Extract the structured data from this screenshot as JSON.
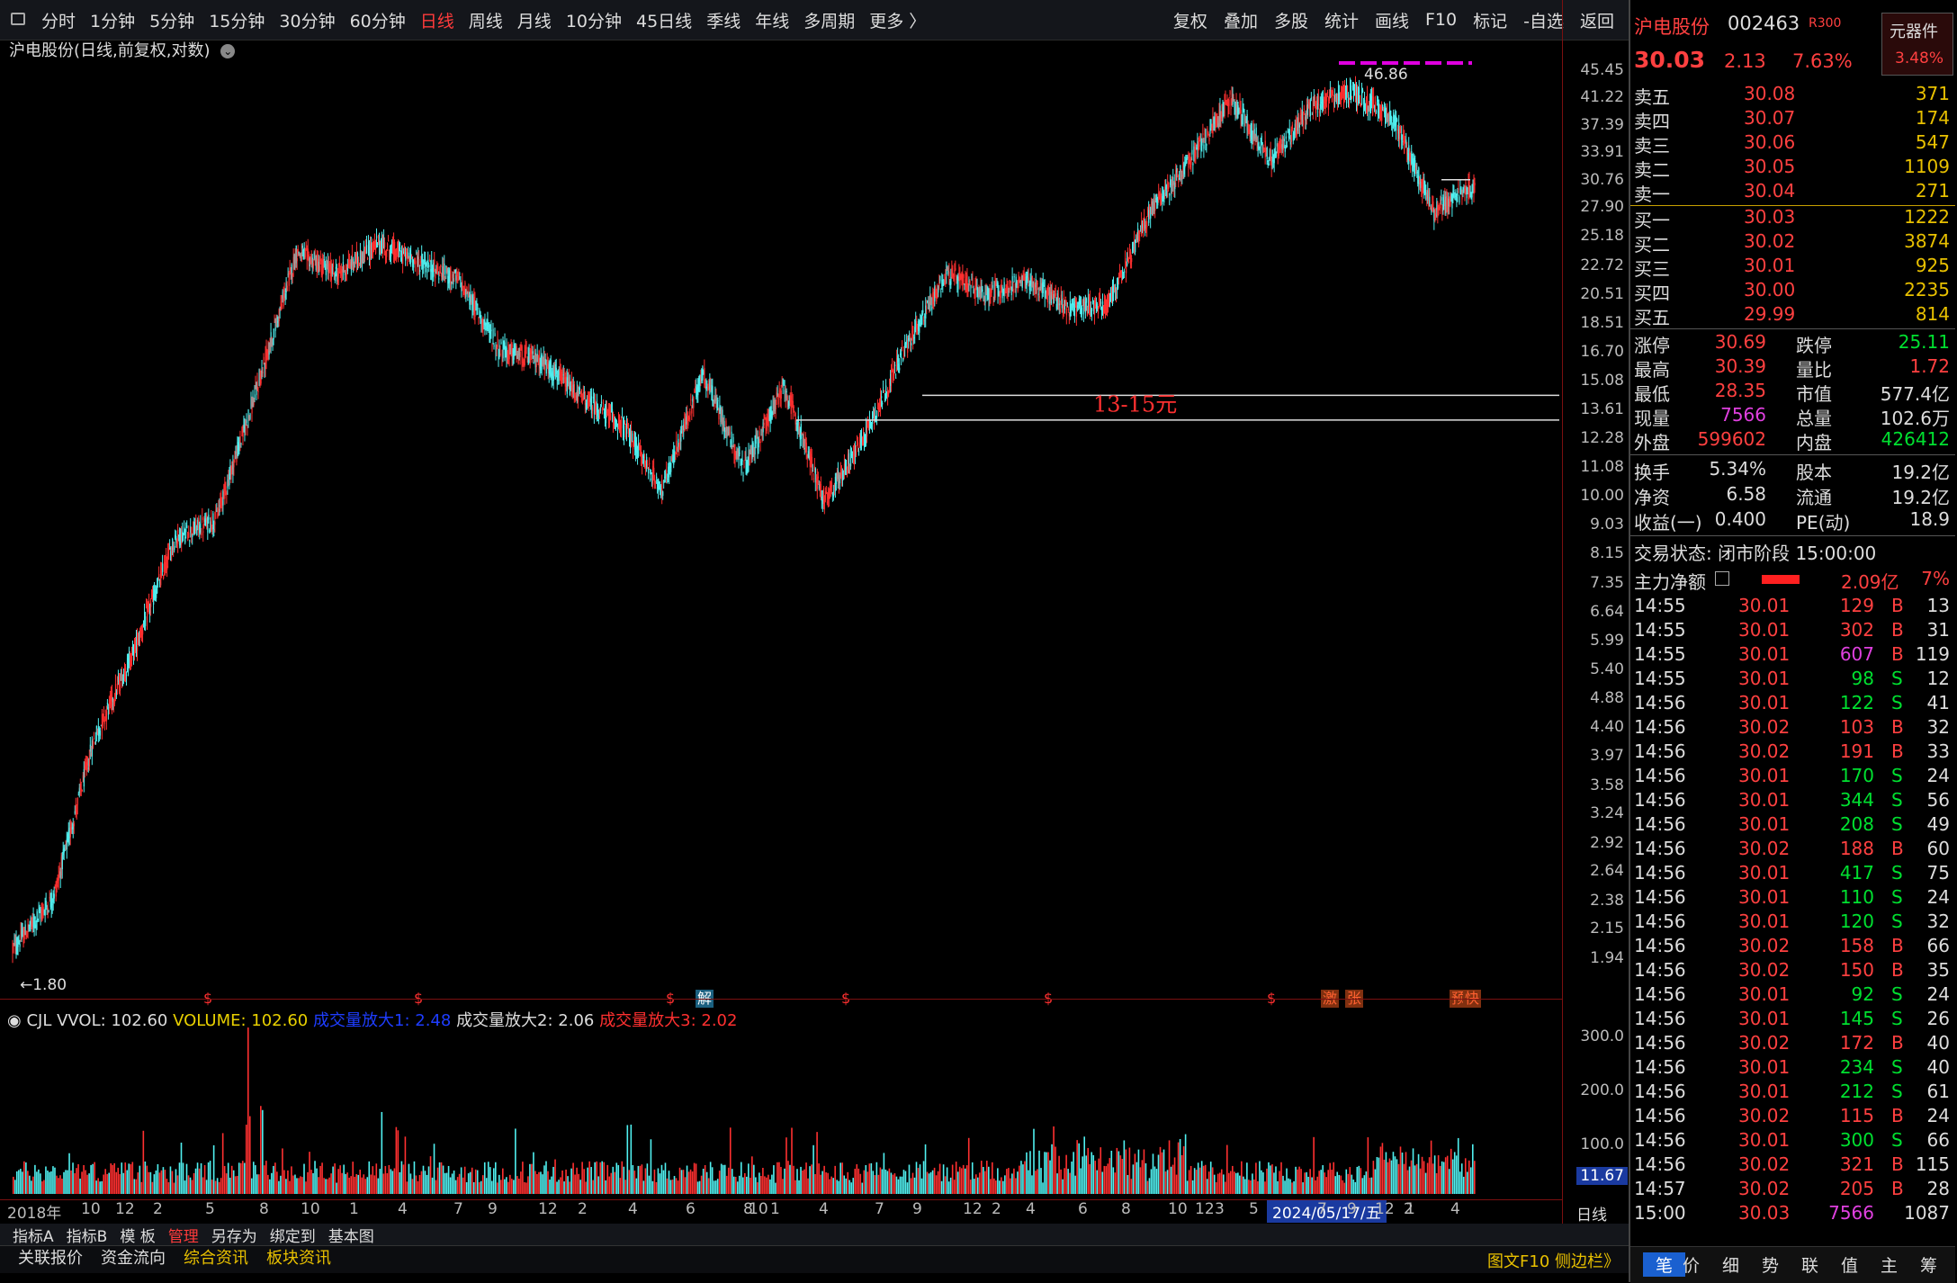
{
  "topbar": {
    "periods": [
      "分时",
      "1分钟",
      "5分钟",
      "15分钟",
      "30分钟",
      "60分钟",
      "日线",
      "周线",
      "月线",
      "10分钟",
      "45日线",
      "季线",
      "年线",
      "多周期",
      "更多 〉"
    ],
    "active_period": "日线",
    "tools": [
      "复权",
      "叠加",
      "多股",
      "统计",
      "画线",
      "F10",
      "标记",
      "-自选",
      "返回"
    ]
  },
  "chart": {
    "title": "沪电股份(日线,前复权,对数)",
    "low_label": "←1.80",
    "high_label": "46.86",
    "annotation": "13-15元",
    "y_ticks": [
      "45.45",
      "41.22",
      "37.39",
      "33.91",
      "30.76",
      "27.90",
      "25.18",
      "22.72",
      "20.51",
      "18.51",
      "16.70",
      "15.08",
      "13.61",
      "12.28",
      "11.08",
      "10.00",
      "9.03",
      "8.15",
      "7.35",
      "6.64",
      "5.99",
      "5.40",
      "4.88",
      "4.40",
      "3.97",
      "3.58",
      "3.24",
      "2.92",
      "2.64",
      "2.38",
      "2.15",
      "1.94"
    ],
    "markers": [
      "$",
      "$",
      "$",
      "解",
      "$",
      "$",
      "$",
      "激",
      "张",
      "预",
      "快"
    ]
  },
  "chart_data": {
    "type": "line",
    "title": "沪电股份(日线,前复权,对数)",
    "y_scale": "log",
    "ylim": [
      1.8,
      46.86
    ],
    "x": [
      "2018年",
      "10",
      "12",
      "2",
      "5",
      "8",
      "10",
      "1",
      "4",
      "7",
      "9",
      "12",
      "2",
      "4",
      "6",
      "8",
      "10",
      "1",
      "4",
      "7",
      "9",
      "12",
      "2",
      "4",
      "6",
      "8",
      "10",
      "12",
      "3",
      "5",
      "7",
      "9",
      "12",
      "2",
      "4",
      "6",
      "8",
      "10",
      "1",
      "4"
    ],
    "close": [
      2.0,
      2.4,
      4.2,
      5.8,
      8.6,
      9.2,
      14.5,
      23.8,
      22.0,
      24.5,
      23.0,
      21.5,
      16.8,
      16.2,
      14.2,
      12.9,
      10.2,
      15.5,
      11.0,
      14.8,
      9.8,
      12.5,
      17.0,
      22.0,
      20.5,
      21.5,
      19.5,
      19.8,
      27.5,
      33.0,
      41.0,
      33.0,
      40.0,
      42.0,
      38.0,
      27.5,
      30.03
    ],
    "volume_series": [
      {
        "name": "VOLUME",
        "value": 102.6
      },
      {
        "name": "成交量放大1",
        "value": 2.48
      },
      {
        "name": "成交量放大2",
        "value": 2.06
      },
      {
        "name": "成交量放大3",
        "value": 2.02
      }
    ],
    "volume_ticks": [
      "300.0",
      "200.0",
      "100.0"
    ],
    "volume_current": "11.67"
  },
  "volume": {
    "prefix": "CJL",
    "vvol": "VVOL: 102.60",
    "volume": "VOLUME: 102.60",
    "amp1": "成交量放大1: 2.48",
    "amp2": "成交量放大2: 2.06",
    "amp3": "成交量放大3: 2.02",
    "ticks": [
      "300.0",
      "200.0",
      "100.0"
    ],
    "current": "11.67"
  },
  "xaxis": {
    "labels": [
      "2018年",
      "10",
      "12",
      "2",
      "5",
      "8",
      "10",
      "1",
      "4",
      "7",
      "9",
      "12",
      "2",
      "4",
      "6",
      "8",
      "10",
      "1",
      "4",
      "7",
      "9",
      "12",
      "2",
      "4",
      "6",
      "8",
      "10",
      "12",
      "3",
      "5",
      "7",
      "9",
      "12",
      "2",
      "1",
      "4"
    ],
    "cursor_date": "2024/05/17/五",
    "period": "日线"
  },
  "bottombar1": {
    "items": [
      "指标A",
      "指标B",
      "模 板",
      "管理",
      "另存为",
      "绑定到",
      "基本图"
    ],
    "active": "管理"
  },
  "bottombar2": {
    "items": [
      "关联报价",
      "资金流向",
      "综合资讯",
      "板块资讯"
    ],
    "right": "图文F10 侧边栏》"
  },
  "quote": {
    "name": "沪电股份",
    "code": "002463",
    "badge": "R300",
    "selector": "元器件",
    "selector_pct": "3.48%",
    "price": "30.03",
    "change": "2.13",
    "pct": "7.63%",
    "asks": [
      {
        "label": "卖五",
        "price": "30.08",
        "vol": "371"
      },
      {
        "label": "卖四",
        "price": "30.07",
        "vol": "174"
      },
      {
        "label": "卖三",
        "price": "30.06",
        "vol": "547"
      },
      {
        "label": "卖二",
        "price": "30.05",
        "vol": "1109"
      },
      {
        "label": "卖一",
        "price": "30.04",
        "vol": "271"
      }
    ],
    "bids": [
      {
        "label": "买一",
        "price": "30.03",
        "vol": "1222"
      },
      {
        "label": "买二",
        "price": "30.02",
        "vol": "3874"
      },
      {
        "label": "买三",
        "price": "30.01",
        "vol": "925"
      },
      {
        "label": "买四",
        "price": "30.00",
        "vol": "2235"
      },
      {
        "label": "买五",
        "price": "29.99",
        "vol": "814"
      }
    ],
    "stats": [
      {
        "l1": "涨停",
        "v1": "30.69",
        "l2": "跌停",
        "v2": "25.11",
        "c1": "r",
        "c2": "g"
      },
      {
        "l1": "最高",
        "v1": "30.39",
        "l2": "量比",
        "v2": "1.72",
        "c1": "r",
        "c2": "r"
      },
      {
        "l1": "最低",
        "v1": "28.35",
        "l2": "市值",
        "v2": "577.4亿",
        "c1": "r",
        "c2": "w"
      },
      {
        "l1": "现量",
        "v1": "7566",
        "l2": "总量",
        "v2": "102.6万",
        "c1": "m",
        "c2": "w"
      },
      {
        "l1": "外盘",
        "v1": "599602",
        "l2": "内盘",
        "v2": "426412",
        "c1": "r",
        "c2": "g"
      }
    ],
    "info": [
      {
        "l1": "换手",
        "v1": "5.34%",
        "l2": "股本",
        "v2": "19.2亿"
      },
      {
        "l1": "净资",
        "v1": "6.58",
        "l2": "流通",
        "v2": "19.2亿"
      },
      {
        "l1": "收益(一)",
        "v1": "0.400",
        "l2": "PE(动)",
        "v2": "18.9"
      }
    ],
    "status": "交易状态: 闭市阶段 15:00:00",
    "mainflow_label": "主力净额",
    "mainflow_value": "2.09亿",
    "mainflow_pct": "7%",
    "ticks": [
      {
        "t": "14:55",
        "p": "30.01",
        "v": "129",
        "s": "B",
        "n": "13"
      },
      {
        "t": "14:55",
        "p": "30.01",
        "v": "302",
        "s": "B",
        "n": "31"
      },
      {
        "t": "14:55",
        "p": "30.01",
        "v": "607",
        "s": "B",
        "n": "119"
      },
      {
        "t": "14:55",
        "p": "30.01",
        "v": "98",
        "s": "S",
        "n": "12"
      },
      {
        "t": "14:56",
        "p": "30.01",
        "v": "122",
        "s": "S",
        "n": "41"
      },
      {
        "t": "14:56",
        "p": "30.02",
        "v": "103",
        "s": "B",
        "n": "32"
      },
      {
        "t": "14:56",
        "p": "30.02",
        "v": "191",
        "s": "B",
        "n": "33"
      },
      {
        "t": "14:56",
        "p": "30.01",
        "v": "170",
        "s": "S",
        "n": "24"
      },
      {
        "t": "14:56",
        "p": "30.01",
        "v": "344",
        "s": "S",
        "n": "56"
      },
      {
        "t": "14:56",
        "p": "30.01",
        "v": "208",
        "s": "S",
        "n": "49"
      },
      {
        "t": "14:56",
        "p": "30.02",
        "v": "188",
        "s": "B",
        "n": "60"
      },
      {
        "t": "14:56",
        "p": "30.01",
        "v": "417",
        "s": "S",
        "n": "75"
      },
      {
        "t": "14:56",
        "p": "30.01",
        "v": "110",
        "s": "S",
        "n": "24"
      },
      {
        "t": "14:56",
        "p": "30.01",
        "v": "120",
        "s": "S",
        "n": "32"
      },
      {
        "t": "14:56",
        "p": "30.02",
        "v": "158",
        "s": "B",
        "n": "66"
      },
      {
        "t": "14:56",
        "p": "30.02",
        "v": "150",
        "s": "B",
        "n": "35"
      },
      {
        "t": "14:56",
        "p": "30.01",
        "v": "92",
        "s": "S",
        "n": "24"
      },
      {
        "t": "14:56",
        "p": "30.01",
        "v": "145",
        "s": "S",
        "n": "26"
      },
      {
        "t": "14:56",
        "p": "30.02",
        "v": "172",
        "s": "B",
        "n": "40"
      },
      {
        "t": "14:56",
        "p": "30.01",
        "v": "234",
        "s": "S",
        "n": "40"
      },
      {
        "t": "14:56",
        "p": "30.01",
        "v": "212",
        "s": "S",
        "n": "61"
      },
      {
        "t": "14:56",
        "p": "30.02",
        "v": "115",
        "s": "B",
        "n": "24"
      },
      {
        "t": "14:56",
        "p": "30.01",
        "v": "300",
        "s": "S",
        "n": "66"
      },
      {
        "t": "14:56",
        "p": "30.02",
        "v": "321",
        "s": "B",
        "n": "115"
      },
      {
        "t": "14:57",
        "p": "30.02",
        "v": "205",
        "s": "B",
        "n": "28"
      },
      {
        "t": "15:00",
        "p": "30.03",
        "v": "7566",
        "s": "",
        "n": "1087"
      }
    ],
    "tabs": [
      "笔",
      "价",
      "细",
      "势",
      "联",
      "值",
      "主",
      "筹"
    ]
  }
}
